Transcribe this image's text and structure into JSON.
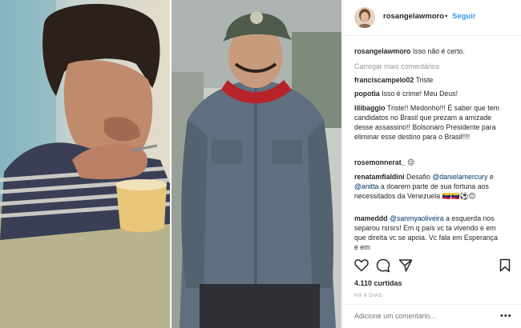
{
  "post": {
    "username": "rosangelawmoro",
    "separator": "•",
    "follow_label": "Seguir",
    "caption": {
      "user": "rosangelawmoro",
      "text": "Isso não é certo."
    },
    "load_more": "Carregar mais comentários",
    "comments": [
      {
        "user": "franciscampelo02",
        "text": "Triste",
        "mention": ""
      },
      {
        "user": "popotia",
        "text": "Isso é crime! Meu Deus!",
        "mention": ""
      },
      {
        "user": "lilibaggio",
        "text": "Triste!! Medonho!!! É saber que tem candidatos no Brasil que prezam a amizade desse assassino!! Bolsonaro Presidente para eliminar esse destino para o Brasil!!!!",
        "mention": ""
      },
      {
        "user": "rosemonnerat_",
        "text": "😔",
        "mention": ""
      },
      {
        "user": "renatamfialdini",
        "text": "Desafio",
        "mention": "@danielamercury",
        "joiner": "e",
        "mention2": "@anitta",
        "text2": "a doarem parte de sua fortuna aos necessitados da Venezuela 🇻🇪🇻🇪⚽😊"
      },
      {
        "user": "mameddd",
        "text": "a esquerda nos separou rsrsrs! Em q país vc ta vivendo e em que direita vc se apoia. Vc fala em Esperança e em",
        "mention": "@sanmyaoliveira"
      }
    ],
    "likes": "4.110 curtidas",
    "time": "HÁ 6 DIAS",
    "add_comment_placeholder": "Adicione um comentário...",
    "options": "•••"
  },
  "colors": {
    "link": "#3897f0",
    "mention": "#003569",
    "muted": "#999999",
    "text": "#262626"
  },
  "icons": [
    "heart-icon",
    "comment-icon",
    "share-icon",
    "bookmark-icon",
    "small-heart-icon",
    "options-icon"
  ]
}
